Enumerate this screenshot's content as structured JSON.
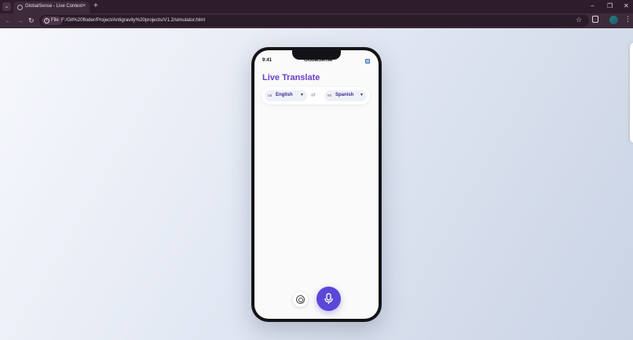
{
  "browser": {
    "tab_title": "GlobalSense - Live Context",
    "tab_close_glyph": "×",
    "new_tab_glyph": "+",
    "file_chip_label": "File",
    "url": "F:/Git%20floder/Project/Antigravity%20projects/V1.2/simulator.html",
    "window_controls": {
      "minimize": "−",
      "restore": "❐",
      "close": "✕"
    },
    "nav": {
      "back": "←",
      "forward": "→",
      "reload": "↻"
    },
    "icons": {
      "bookmark": "star-icon",
      "extensions": "puzzle-icon",
      "menu": "kebab-icon"
    }
  },
  "phone": {
    "status_time": "9:41",
    "app_name": "GlobalSense",
    "page_title": "Live Translate",
    "source_lang": {
      "code": "us",
      "name": "English",
      "arrow": "▼"
    },
    "swap_glyph": "⇄",
    "target_lang": {
      "code": "es",
      "name": "Spanish",
      "arrow": "▼"
    }
  },
  "colors": {
    "accent": "#6a3fc8",
    "mic_button": "#5a48d8",
    "browser_frame": "#2e1c2c"
  }
}
